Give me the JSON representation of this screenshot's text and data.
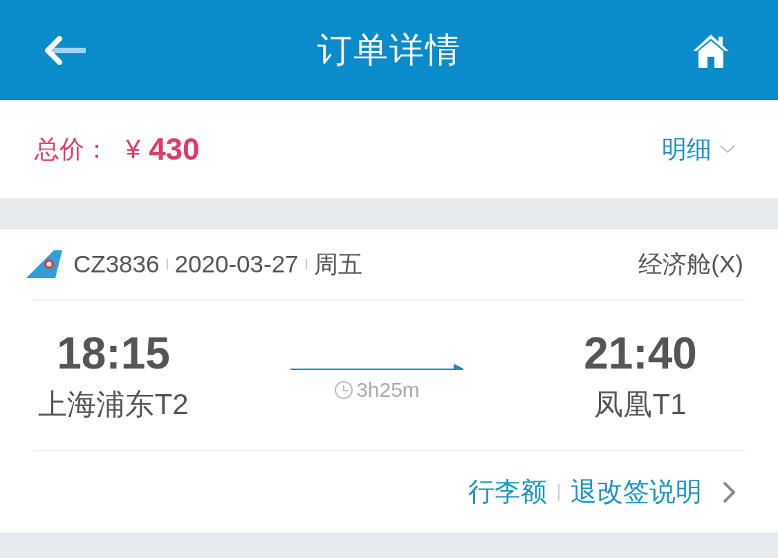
{
  "header": {
    "title": "订单详情"
  },
  "price": {
    "label": "总价：",
    "currency": "¥",
    "amount": "430",
    "detail_link": "明细"
  },
  "flight": {
    "flight_number": "CZ3836",
    "date": "2020-03-27",
    "weekday": "周五",
    "cabin": "经济舱(X)",
    "departure": {
      "time": "18:15",
      "station": "上海浦东T2"
    },
    "arrival": {
      "time": "21:40",
      "station": "凤凰T1"
    },
    "duration": "3h25m"
  },
  "links": [
    {
      "label": "行李额"
    },
    {
      "label": "退改签说明"
    }
  ]
}
